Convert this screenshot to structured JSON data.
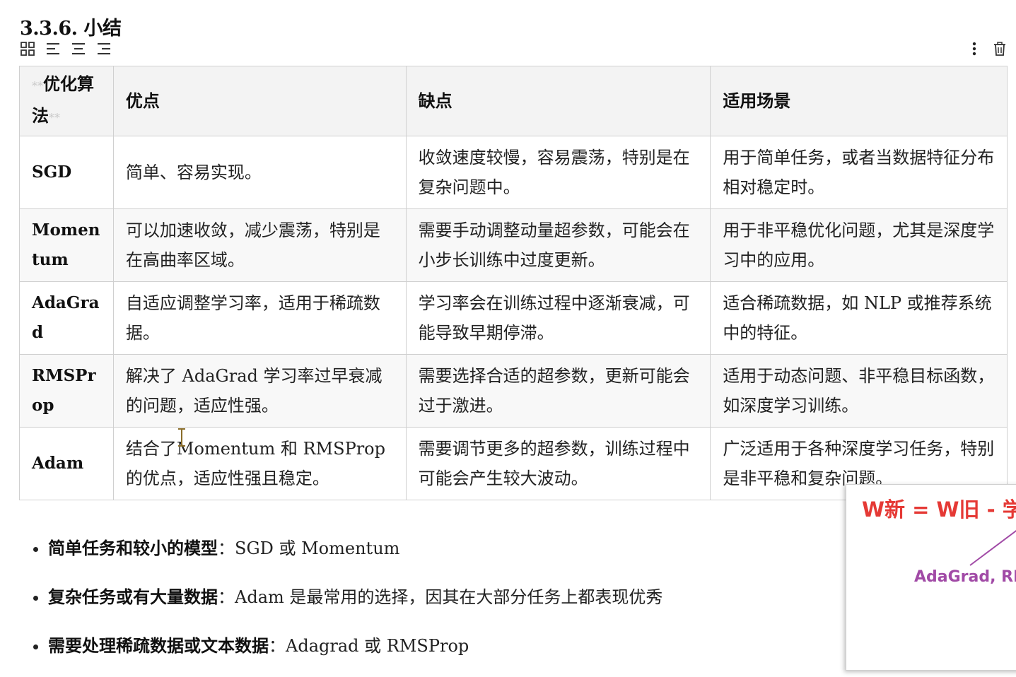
{
  "heading": "3.3.6. 小结",
  "toolbar": {
    "icons": [
      "grid-icon",
      "align-left-icon",
      "align-center-icon",
      "align-right-icon"
    ],
    "right_icons": [
      "more-vertical-icon",
      "trash-icon"
    ]
  },
  "table": {
    "headers": {
      "col0_prefix": "**",
      "col0": "优化算法",
      "col0_suffix": "**",
      "col1": "优点",
      "col2": "缺点",
      "col3": "适用场景"
    },
    "rows": [
      {
        "algo": "SGD",
        "pros": "简单、容易实现。",
        "cons": "收敛速度较慢，容易震荡，特别是在复杂问题中。",
        "use": "用于简单任务，或者当数据特征分布相对稳定时。"
      },
      {
        "algo": "Momentum",
        "pros": "可以加速收敛，减少震荡，特别是在高曲率区域。",
        "cons": "需要手动调整动量超参数，可能会在小步长训练中过度更新。",
        "use": "用于非平稳优化问题，尤其是深度学习中的应用。"
      },
      {
        "algo": "AdaGrad",
        "pros": "自适应调整学习率，适用于稀疏数据。",
        "cons": "学习率会在训练过程中逐渐衰减，可能导致早期停滞。",
        "use": "适合稀疏数据，如 NLP 或推荐系统中的特征。"
      },
      {
        "algo": "RMSProp",
        "pros": "解决了 AdaGrad 学习率过早衰减的问题，适应性强。",
        "cons": "需要选择合适的超参数，更新可能会过于激进。",
        "use": "适用于动态问题、非平稳目标函数，如深度学习训练。"
      },
      {
        "algo": "Adam",
        "pros": "结合了Momentum 和 RMSProp 的优点，适应性强且稳定。",
        "cons": "需要调节更多的超参数，训练过程中可能会产生较大波动。",
        "use": "广泛适用于各种深度学习任务，特别是非平稳和复杂问题。"
      }
    ]
  },
  "recommendations": [
    {
      "label": "简单任务和较小的模型",
      "text": "：SGD 或 Momentum"
    },
    {
      "label": "复杂任务或有大量数据",
      "text": "：Adam 是最常用的选择，因其在大部分任务上都表现优秀"
    },
    {
      "label": "需要处理稀疏数据或文本数据",
      "text": "：Adagrad 或 RMSProp"
    }
  ],
  "overlay": {
    "formula": "W新 = W旧 - 学",
    "label": "AdaGrad, RM",
    "formula_color": "#e53935",
    "label_color": "#a14aa6"
  }
}
